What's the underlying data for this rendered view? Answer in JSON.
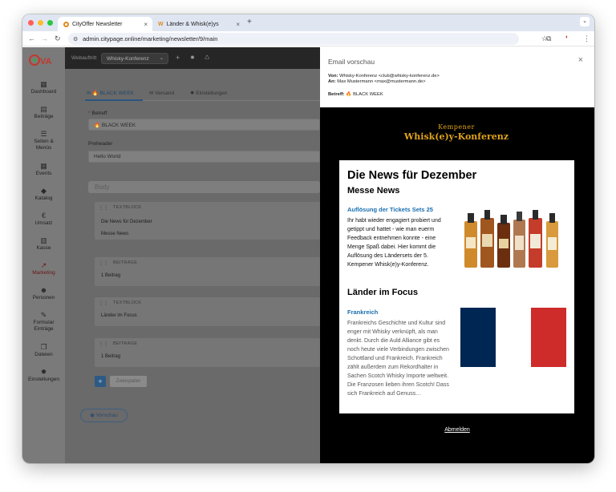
{
  "browser": {
    "tabs": [
      {
        "title": "CityOffer Newsletter",
        "active": true
      },
      {
        "title": "Länder & Whisk(e)ys",
        "active": false
      }
    ],
    "url": "admin.citypage.online/marketing/newsletter/9/main"
  },
  "topbar": {
    "label": "Webauftritt",
    "select_value": "Whisky-Konferenz"
  },
  "sidebar": {
    "items": [
      {
        "label": "Dashboard",
        "icon": "dashboard-icon"
      },
      {
        "label": "Beiträge",
        "icon": "posts-icon"
      },
      {
        "label": "Seiten & Menüs",
        "icon": "menu-icon"
      },
      {
        "label": "Events",
        "icon": "calendar-icon"
      },
      {
        "label": "Katalog",
        "icon": "tag-icon"
      },
      {
        "label": "Umsatz",
        "icon": "euro-icon"
      },
      {
        "label": "Kasse",
        "icon": "register-icon"
      },
      {
        "label": "Marketing",
        "icon": "chart-icon",
        "active": true
      },
      {
        "label": "Personen",
        "icon": "people-icon"
      },
      {
        "label": "Formular Einträge",
        "icon": "form-icon"
      },
      {
        "label": "Dateien",
        "icon": "files-icon"
      },
      {
        "label": "Einstellungen",
        "icon": "gear-icon"
      }
    ]
  },
  "editor": {
    "tabs": [
      "🔥 BLACK WEEK",
      "Versand",
      "Einstellungen"
    ],
    "subject_label": "Betreff",
    "subject_value": "🔥 BLACK WEEK",
    "preheader_label": "Preheader",
    "preheader_value": "Hello World",
    "body_label": "Body",
    "blocks": [
      {
        "type": "TEXTBLOCK",
        "lines": [
          "Die News für Dezember",
          "Messe News"
        ]
      },
      {
        "type": "BEITRAGE",
        "lines": [
          "1 Beitrag"
        ]
      },
      {
        "type": "TEXTBLOCK",
        "lines": [
          "Länder im Focus"
        ]
      },
      {
        "type": "BEITRAGE",
        "lines": [
          "1 Beitrag"
        ]
      }
    ],
    "add_label": "+",
    "twocol_label": "Zweispalter",
    "preview_label": "Vorschau"
  },
  "preview": {
    "title": "Email vorschau",
    "from_label": "Von:",
    "from_value": "Whisky-Konferenz <club@whisky-konferenz.de>",
    "to_label": "An:",
    "to_value": "Max Mustermann <max@mustermann.de>",
    "subject_label": "Betreff:",
    "subject_value": "🔥 BLACK WEEK",
    "brand_top": "Kempener",
    "brand_main": "Whisk(e)y-Konferenz",
    "heading": "Die News für Dezember",
    "section1": "Messe News",
    "article1_title": "Auflösung der Tickets Sets 25",
    "article1_text": "Ihr habt wieder engagiert probiert und getippt und hattet - wie man euerm Feedback entnehmen konnte - eine Menge Spaß dabei. Hier kommt die Auflösung des Ländersets der 5. Kempener Whisk(e)y-Konferenz.",
    "section2": "Länder im Focus",
    "article2_title": "Frankreich",
    "article2_text": "Frankreichs Geschichte und Kultur sind enger mit Whisky verknüpft, als man denkt. Durch die Auld Alliance gibt es noch heute viele Verbindungen zwischen Schottland und Frankreich. Frankreich zählt außerdem zum Rekordhalter in Sachen Scotch Whisky Importe weltweit. Die Franzosen lieben ihren Scotch! Dass sich Frankreich auf Genuss…",
    "unsubscribe": "Abmelden"
  },
  "colors": {
    "accent": "#1a6fb0",
    "flag_blue": "#002654",
    "flag_red": "#ce2b2b",
    "brand_gold": "#e0a31d"
  }
}
